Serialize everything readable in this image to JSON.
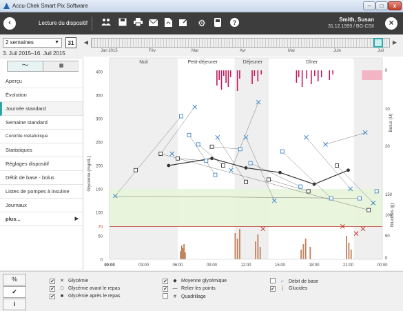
{
  "window": {
    "title": "Accu-Chek Smart Pix Software",
    "min_label": "–",
    "max_label": "□",
    "close_label": "x"
  },
  "toolbar": {
    "back_icon": "back-arrow-icon",
    "title": "Lecture du dispositif",
    "icons": [
      "group-icon",
      "save-icon",
      "print-icon",
      "email-icon",
      "pdf-icon",
      "export-icon",
      "gear-icon",
      "device-icon",
      "help-icon"
    ],
    "user_name": "Smith, Susan",
    "user_dob": "31.12.1999 / BG-CSII",
    "close_icon": "close-icon"
  },
  "period": {
    "selected": "2 semaines",
    "calendar_label": "31",
    "range": "3. Juil 2015–16. Juil 2015"
  },
  "timeline": {
    "months": [
      "Jan 2015",
      "Fév",
      "Mar",
      "Avr",
      "Mai",
      "Juin",
      "Juil"
    ]
  },
  "sidebar": {
    "toggle_graph": "〜",
    "toggle_table": "▦",
    "items": [
      {
        "label": "Aperçu"
      },
      {
        "label": "Évolution"
      },
      {
        "label": "Journée standard",
        "active": true
      },
      {
        "label": "Semaine standard"
      },
      {
        "label": "Contrôle métabolique"
      },
      {
        "label": "Statistiques"
      },
      {
        "label": "Réglages dispositif"
      },
      {
        "label": "Débit de base - bolus"
      },
      {
        "label": "Listes de pompes à insuline"
      },
      {
        "label": "Journaux"
      },
      {
        "label": "plus..."
      }
    ]
  },
  "chart_data": {
    "type": "scatter",
    "periods": [
      "Nuit",
      "Petit-déjeuner",
      "Déjeuner",
      "Dîner"
    ],
    "x_ticks": [
      "00:00",
      "03:00",
      "06:00",
      "09:00",
      "12:00",
      "15:00",
      "18:00",
      "21:00",
      "00:00"
    ],
    "y_left_ticks": [
      0,
      50,
      70,
      100,
      150,
      200,
      250,
      300,
      350,
      400
    ],
    "y_left_label": "Glycémie (mg/dL)",
    "ylim": [
      0,
      400
    ],
    "xlim": [
      0,
      24
    ],
    "target_range": [
      70,
      150
    ],
    "threshold_low": 70,
    "y_right_bolus_label": "Bolus (U)",
    "y_right_bolus_ticks": [
      0,
      10,
      20
    ],
    "y_right_carbs_label": "Glucides (g)",
    "y_right_carbs_ticks": [
      0,
      50,
      100,
      150
    ],
    "legend": {
      "glycemie": "Glycémie",
      "avant_repas": "Glycémie avant le repas",
      "apres_repas": "Glycémie après le repas",
      "moyenne": "Moyenne glycémique",
      "relier": "Relier les points",
      "quadrillage": "Quadrillage",
      "debit_base": "Débit de base",
      "glucides": "Glucides"
    },
    "mean_series": [
      [
        5.2,
        200
      ],
      [
        9.0,
        215
      ],
      [
        12.0,
        195
      ],
      [
        15.0,
        185
      ],
      [
        18.0,
        160
      ],
      [
        21.0,
        190
      ]
    ],
    "glycemia_points": [
      [
        0.5,
        135
      ],
      [
        5.5,
        225
      ],
      [
        7.5,
        325
      ],
      [
        9.5,
        260
      ],
      [
        10.7,
        190
      ],
      [
        12.0,
        260
      ],
      [
        13.1,
        335
      ],
      [
        14.5,
        125
      ],
      [
        17.3,
        260
      ],
      [
        19.0,
        245
      ],
      [
        21.2,
        150
      ],
      [
        22.5,
        270
      ],
      [
        23.2,
        120
      ]
    ],
    "before_meal_points": [
      [
        6.3,
        305
      ],
      [
        7.0,
        265
      ],
      [
        7.8,
        245
      ],
      [
        8.5,
        210
      ],
      [
        9.3,
        180
      ],
      [
        11.5,
        235
      ],
      [
        12.4,
        205
      ],
      [
        15.2,
        230
      ],
      [
        16.8,
        155
      ],
      [
        19.5,
        130
      ],
      [
        22.0,
        130
      ],
      [
        23.5,
        145
      ]
    ],
    "after_meal_points": [
      [
        2.3,
        190
      ],
      [
        4.5,
        225
      ],
      [
        6.0,
        215
      ],
      [
        9.0,
        240
      ],
      [
        10.0,
        200
      ],
      [
        12.0,
        165
      ],
      [
        14.0,
        170
      ],
      [
        17.5,
        145
      ],
      [
        20.0,
        200
      ],
      [
        22.8,
        105
      ]
    ],
    "low_points": [
      [
        13.5,
        65
      ],
      [
        20.5,
        70
      ],
      [
        21.7,
        55
      ],
      [
        22.3,
        65
      ]
    ]
  },
  "bottom": {
    "tab_percent": "%",
    "tab_check": "✔",
    "tab_info": "i"
  }
}
